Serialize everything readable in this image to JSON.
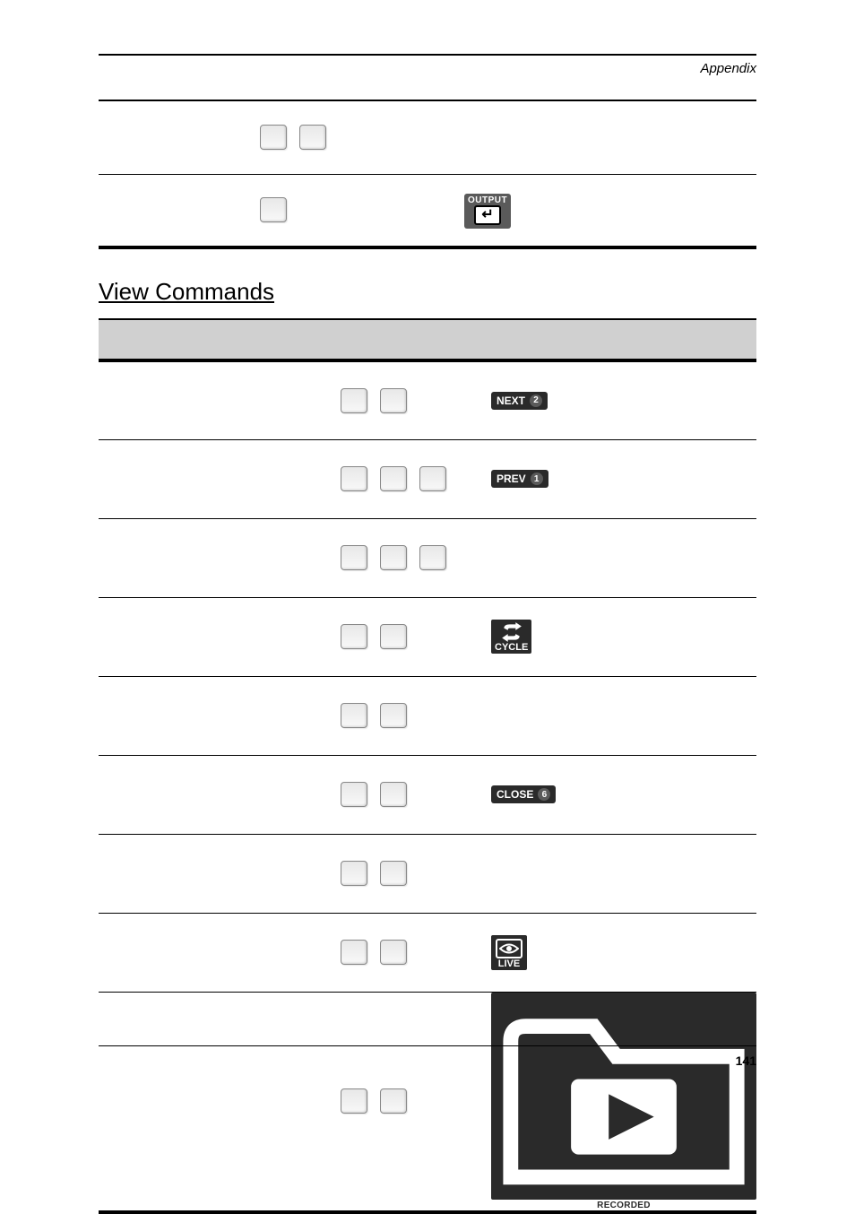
{
  "header": {
    "section": "Appendix"
  },
  "section_title": "View Commands",
  "top_table": {
    "rows": [
      {
        "keys": 2,
        "button": null
      },
      {
        "keys": 1,
        "button": "output"
      }
    ]
  },
  "cmd_table": {
    "headers": [
      "",
      "",
      ""
    ],
    "rows": [
      {
        "keys": 2,
        "button": {
          "type": "label-pill",
          "label": "NEXT",
          "pill": "2"
        }
      },
      {
        "keys": 3,
        "button": {
          "type": "label-pill",
          "label": "PREV",
          "pill": "1"
        }
      },
      {
        "keys": 3,
        "button": null
      },
      {
        "keys": 2,
        "button": {
          "type": "cycle",
          "label": "CYCLE"
        }
      },
      {
        "keys": 2,
        "button": null
      },
      {
        "keys": 2,
        "button": {
          "type": "label-pill",
          "label": "CLOSE",
          "pill": "6"
        }
      },
      {
        "keys": 2,
        "button": null
      },
      {
        "keys": 2,
        "button": {
          "type": "live",
          "label": "LIVE"
        }
      },
      {
        "keys": 2,
        "button": {
          "type": "recorded",
          "label": "RECORDED"
        }
      }
    ]
  },
  "footer": {
    "page": "141"
  }
}
